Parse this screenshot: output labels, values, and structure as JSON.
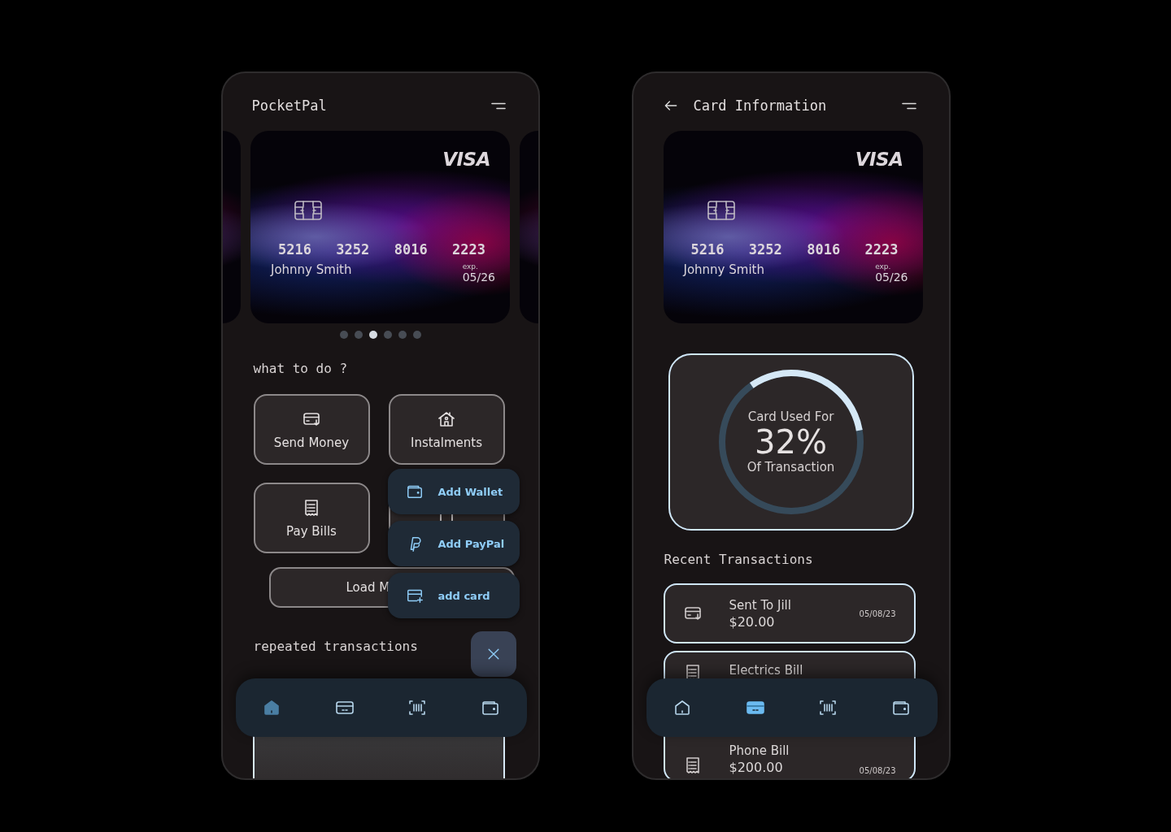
{
  "screens": [
    {
      "kind": "home",
      "title": "PocketPal",
      "card": {
        "brand": "VISA",
        "number": [
          "5216",
          "3252",
          "8016",
          "2223"
        ],
        "holder": "Johnny Smith",
        "exp_label": "exp.",
        "exp": "05/26"
      },
      "carousel_dots": [
        {
          "selected": false
        },
        {
          "selected": false
        },
        {
          "selected": true
        },
        {
          "selected": false
        },
        {
          "selected": false
        },
        {
          "selected": false
        }
      ],
      "section_title": "what to do ?",
      "actions": [
        {
          "kind": "send",
          "label": "Send Money"
        },
        {
          "kind": "house",
          "label": "Instalments"
        },
        {
          "kind": "bill",
          "label": "Pay Bills"
        },
        {
          "kind": "receipt"
        }
      ],
      "wide_action": {
        "label": "Load M"
      },
      "menu": [
        {
          "kind": "wallet",
          "label": "Add Wallet"
        },
        {
          "kind": "paypal",
          "label": "Add PayPal"
        },
        {
          "kind": "add-card",
          "label": "add card"
        }
      ],
      "section_title_2": "repeated transactions",
      "nav": [
        {
          "kind": "home",
          "selected": true
        },
        {
          "kind": "card",
          "selected": false
        },
        {
          "kind": "scan",
          "selected": false
        },
        {
          "kind": "wallet",
          "selected": false
        }
      ]
    },
    {
      "kind": "card-info",
      "title": "Card Information",
      "card": {
        "brand": "VISA",
        "number": [
          "5216",
          "3252",
          "8016",
          "2223"
        ],
        "holder": "Johnny Smith",
        "exp_label": "exp.",
        "exp": "05/26"
      },
      "usage": {
        "caption_top": "Card Used For",
        "value": "32%",
        "caption_bottom": "Of Transaction",
        "level": 0.32
      },
      "section_title": "Recent Transactions",
      "transactions": [
        {
          "kind": "send",
          "title": "Sent To Jill",
          "amount": "$20.00",
          "date": "05/08/23"
        },
        {
          "kind": "bill",
          "title": "Electrics Bill"
        },
        {
          "kind": "bill",
          "title": "Phone Bill",
          "amount": "$200.00",
          "date": "05/08/23"
        }
      ],
      "nav": [
        {
          "kind": "home",
          "selected": false
        },
        {
          "kind": "card",
          "selected": true
        },
        {
          "kind": "scan",
          "selected": false
        },
        {
          "kind": "wallet",
          "selected": false
        }
      ]
    }
  ]
}
